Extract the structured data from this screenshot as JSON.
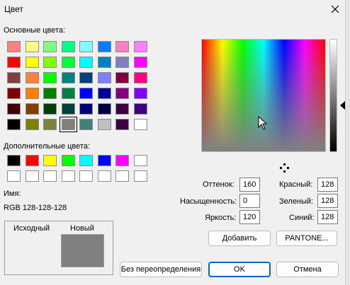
{
  "window": {
    "title": "Цвет"
  },
  "basic": {
    "label": "Основные цвета:",
    "rows": [
      [
        "#ff8080",
        "#ffff80",
        "#80ff80",
        "#00ff80",
        "#80ffff",
        "#0080ff",
        "#ff80c0",
        "#ff80ff"
      ],
      [
        "#ff0000",
        "#ffff00",
        "#80ff00",
        "#00ff40",
        "#00ffff",
        "#0080c0",
        "#8080c0",
        "#ff00ff"
      ],
      [
        "#804040",
        "#ff8040",
        "#00ff00",
        "#008080",
        "#004080",
        "#8080ff",
        "#800040",
        "#ff0080"
      ],
      [
        "#800000",
        "#ff8000",
        "#008000",
        "#008040",
        "#0000ff",
        "#0000a0",
        "#800080",
        "#8000ff"
      ],
      [
        "#400000",
        "#804000",
        "#004000",
        "#004040",
        "#000080",
        "#000040",
        "#400040",
        "#400080"
      ],
      [
        "#000000",
        "#808000",
        "#808040",
        "#808080",
        "#408080",
        "#c0c0c0",
        "#400040",
        "#ffffff"
      ]
    ]
  },
  "custom": {
    "label": "Дополнительные цвета:",
    "rows": [
      [
        "#000000",
        "#ff0000",
        "#ffff00",
        "#00ff00",
        "#00ffff",
        "#0000ff",
        "#ff00ff",
        "#ffffff"
      ],
      [
        "#ffffff",
        "#ffffff",
        "#ffffff",
        "#ffffff",
        "#ffffff",
        "#ffffff",
        "#ffffff",
        "#ffffff"
      ]
    ]
  },
  "name": {
    "label": "Имя:",
    "value": "RGB 128-128-128"
  },
  "preview": {
    "old_label": "Исходный",
    "new_label": "Новый"
  },
  "hsl": {
    "hue_label": "Оттенок:",
    "hue": "160",
    "sat_label": "Насыщенность:",
    "sat": "0",
    "lum_label": "Яркость:",
    "lum": "120"
  },
  "rgb": {
    "red_label": "Красный:",
    "red": "128",
    "green_label": "Зеленый:",
    "green": "128",
    "blue_label": "Синий:",
    "blue": "128"
  },
  "buttons": {
    "add": "Добавить",
    "pantone": "PANTONE...",
    "no_override": "Без переопределения",
    "ok": "OK",
    "cancel": "Отмена"
  }
}
